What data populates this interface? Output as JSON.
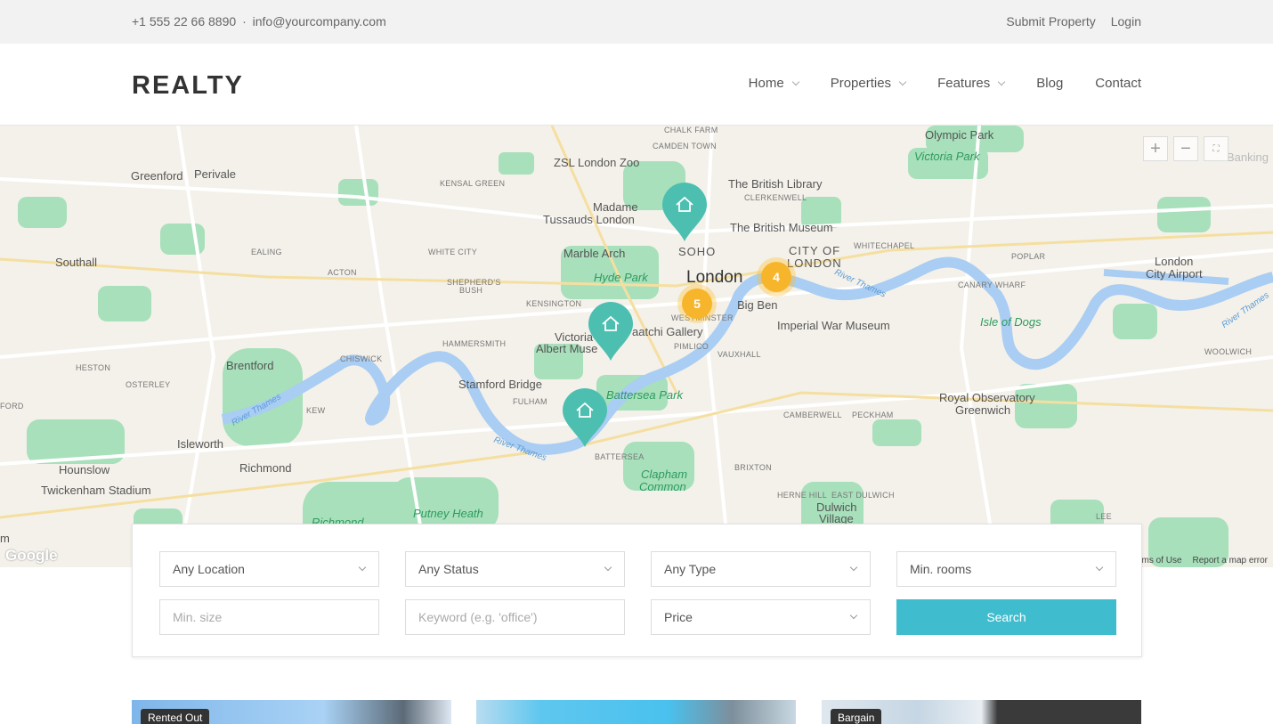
{
  "topbar": {
    "phone": "+1 555 22 66 8890",
    "separator": "·",
    "email": "info@yourcompany.com",
    "submit_property": "Submit Property",
    "login": "Login"
  },
  "header": {
    "logo": "REALTY",
    "nav": {
      "home": "Home",
      "properties": "Properties",
      "features": "Features",
      "blog": "Blog",
      "contact": "Contact"
    }
  },
  "map": {
    "zoom_in": "+",
    "zoom_out": "−",
    "fullscreen": "⛶",
    "google": "Google",
    "terms": "rms of Use",
    "report": "Report a map error",
    "clusters": {
      "london": "4",
      "westminster": "5"
    },
    "labels": {
      "london": "London",
      "soho": "SOHO",
      "city1": "CITY OF",
      "city2": "LONDON",
      "greenford": "Greenford",
      "perivale": "Perivale",
      "southall": "Southall",
      "brentford": "Brentford",
      "isleworth": "Isleworth",
      "hounslow": "Hounslow",
      "richmond": "Richmond",
      "twickenham": "Twickenham Stadium",
      "zoo": "ZSL London Zoo",
      "madame": "Madame",
      "tussauds": "Tussauds London",
      "library": "The British Library",
      "museum": "The British Museum",
      "marble": "Marble Arch",
      "hyde": "Hyde Park",
      "bigben": "Big Ben",
      "war": "Imperial War Museum",
      "saatchi": "aatchi Gallery",
      "victoria1": "Victoria",
      "victoria2": "Albert Muse",
      "stamford": "Stamford Bridge",
      "battersea_park": "Battersea Park",
      "clapham1": "Clapham",
      "clapham2": "Common",
      "putney": "Putney Heath",
      "richmond_park": "Richmond",
      "olympic": "Olympic Park",
      "victoria_park": "Victoria Park",
      "city_airport1": "London",
      "city_airport2": "City Airport",
      "isle": "Isle of Dogs",
      "observatory1": "Royal Observatory",
      "observatory2": "Greenwich",
      "dulwich1": "Dulwich",
      "dulwich2": "Village",
      "camden": "CAMDEN TOWN",
      "chalk": "CHALK FARM",
      "kensal": "KENSAL GREEN",
      "clerkenwell": "CLERKENWELL",
      "whitechapel": "WHITECHAPEL",
      "poplar": "POPLAR",
      "canary": "CANARY WHARF",
      "woolwich": "WOOLWICH",
      "white_city": "WHITE CITY",
      "ealing": "EALING",
      "acton": "ACTON",
      "shepherds1": "SHEPHERD'S",
      "shepherds2": "BUSH",
      "kensington": "KENSINGTON",
      "hammersmith": "HAMMERSMITH",
      "chiswick": "CHISWICK",
      "heston": "HESTON",
      "osterley": "OSTERLEY",
      "kew": "KEW",
      "fulham": "FULHAM",
      "battersea": "BATTERSEA",
      "vauxhall": "VAUXHALL",
      "pimlico": "PIMLICO",
      "westminster": "WESTMINSTER",
      "camberwell": "CAMBERWELL",
      "peckham": "PECKHAM",
      "brixton": "BRIXTON",
      "herne": "HERNE HILL",
      "east_dulwich": "EAST DULWICH",
      "lee": "LEE",
      "ford": "FORD",
      "banking": "Banking",
      "m_edge": "m",
      "river1": "River Thames",
      "river2": "River Thames",
      "river3": "River Thames",
      "river4": "River Thames"
    }
  },
  "search": {
    "location": "Any Location",
    "status": "Any Status",
    "type": "Any Type",
    "rooms": "Min. rooms",
    "size_placeholder": "Min. size",
    "keyword_placeholder": "Keyword (e.g. 'office')",
    "price": "Price",
    "button": "Search"
  },
  "listings": [
    {
      "badge": "Rented Out"
    },
    {
      "badge": ""
    },
    {
      "badge": "Bargain"
    }
  ],
  "colors": {
    "accent": "#3fbccd",
    "pin": "#4dbfb0",
    "cluster": "#f7b52c",
    "park": "#9bdcb0",
    "water": "#a9cdf3"
  }
}
